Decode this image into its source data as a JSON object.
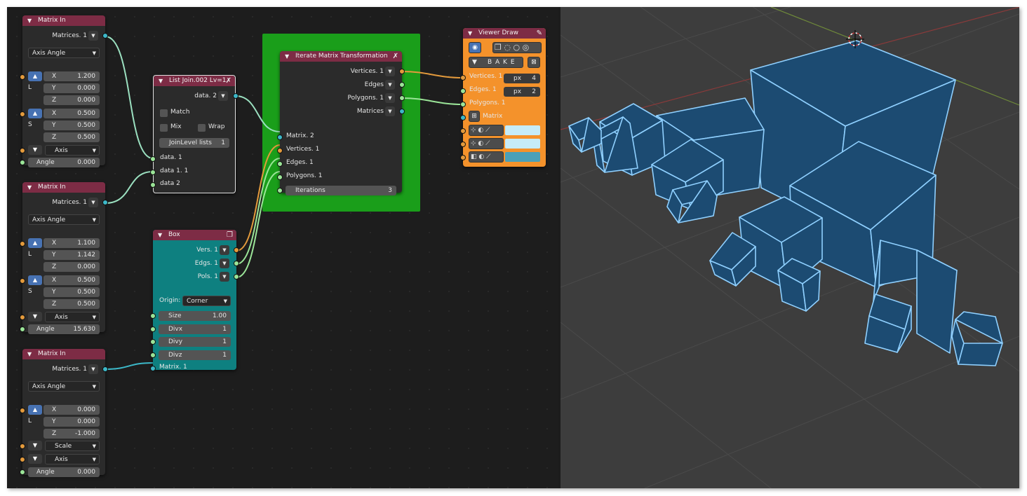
{
  "colors": {
    "accent": "#4772b3",
    "header": "#7d2c45",
    "frame": "#1a9e1a",
    "box_node": "#0e8080",
    "viewer_node": "#f4922b",
    "cube_fill": "#1c4b72",
    "cube_edge": "#8fd0ff"
  },
  "matrix_in_1": {
    "title": "Matrix In",
    "output": "Matrices. 1",
    "mode": "Axis Angle",
    "l_label": "L",
    "s_label": "S",
    "x1": {
      "label": "X",
      "value": "1.200"
    },
    "y1": {
      "label": "Y",
      "value": "0.000"
    },
    "z1": {
      "label": "Z",
      "value": "0.000"
    },
    "x2": {
      "label": "X",
      "value": "0.500"
    },
    "y2": {
      "label": "Y",
      "value": "0.500"
    },
    "z2": {
      "label": "Z",
      "value": "0.500"
    },
    "axis": "Axis",
    "angle": {
      "label": "Angle",
      "value": "0.000"
    }
  },
  "matrix_in_2": {
    "title": "Matrix In",
    "output": "Matrices. 1",
    "mode": "Axis Angle",
    "l_label": "L",
    "s_label": "S",
    "x1": {
      "label": "X",
      "value": "1.100"
    },
    "y1": {
      "label": "Y",
      "value": "1.142"
    },
    "z1": {
      "label": "Z",
      "value": "0.000"
    },
    "x2": {
      "label": "X",
      "value": "0.500"
    },
    "y2": {
      "label": "Y",
      "value": "0.500"
    },
    "z2": {
      "label": "Z",
      "value": "0.500"
    },
    "axis": "Axis",
    "angle": {
      "label": "Angle",
      "value": "15.630"
    }
  },
  "matrix_in_3": {
    "title": "Matrix In",
    "output": "Matrices. 1",
    "mode": "Axis Angle",
    "l_label": "L",
    "x1": {
      "label": "X",
      "value": "0.000"
    },
    "y1": {
      "label": "Y",
      "value": "0.000"
    },
    "z1": {
      "label": "Z",
      "value": "-1.000"
    },
    "scale": "Scale",
    "axis": "Axis",
    "angle": {
      "label": "Angle",
      "value": "0.000"
    }
  },
  "list_join": {
    "title": "List Join.002 Lv=1",
    "output": "data. 2",
    "match": "Match",
    "mix": "Mix",
    "wrap": "Wrap",
    "join_label": "JoinLevel lists",
    "join_value": "1",
    "in1": "data. 1",
    "in2": "data 1. 1",
    "in3": "data 2"
  },
  "box": {
    "title": "Box",
    "out_verts": "Vers. 1",
    "out_edges": "Edgs. 1",
    "out_polys": "Pols. 1",
    "origin_label": "Origin:",
    "origin_value": "Corner",
    "size": {
      "label": "Size",
      "value": "1.00"
    },
    "divx": {
      "label": "Divx",
      "value": "1"
    },
    "divy": {
      "label": "Divy",
      "value": "1"
    },
    "divz": {
      "label": "Divz",
      "value": "1"
    },
    "in_matrix": "Matrix. 1"
  },
  "iterate": {
    "title": "Iterate Matrix Transformation",
    "out_verts": "Vertices. 1",
    "out_edges": "Edges",
    "out_polys": "Polygons. 1",
    "out_mats": "Matrices",
    "in_matrix": "Matrix. 2",
    "in_verts": "Vertices. 1",
    "in_edges": "Edges. 1",
    "in_polys": "Polygons. 1",
    "iterations": {
      "label": "Iterations",
      "value": "3"
    }
  },
  "viewer": {
    "title": "Viewer Draw",
    "bake": "B A K E",
    "in_verts": "Vertices. 1",
    "in_edges": "Edges. 1",
    "in_polys": "Polygons. 1",
    "in_matrix": "Matrix",
    "px_label": "px",
    "vert_px": "4",
    "edge_px": "2",
    "color1": "#c6ecf8",
    "color2": "#c6ecf8",
    "color3": "#4aa0b8"
  }
}
